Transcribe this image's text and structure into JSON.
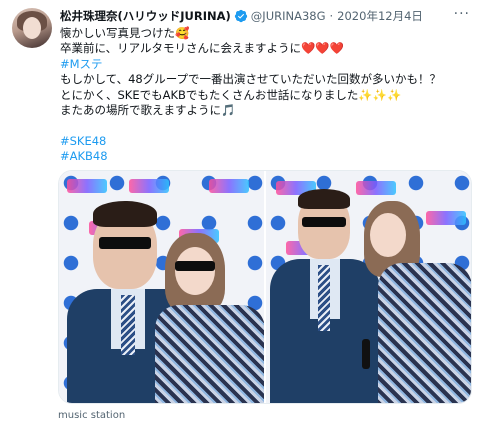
{
  "tweet": {
    "display_name": "松井珠理奈(ハリウッドJURINA)",
    "handle": "@JURINA38G",
    "separator": "·",
    "date": "2020年12月4日",
    "more_label": "···",
    "lines": [
      {
        "text": "懐かしい写真見つけた",
        "emoji": "🥰"
      },
      {
        "text": "卒業前に、リアルタモリさんに会えますように",
        "emoji": "❤️❤️❤️"
      },
      {
        "text": "#Mステ"
      },
      {
        "text": "もしかして、48グループで一番出演させていただいた回数が多いかも！？"
      },
      {
        "text": "とにかく、SKEでもAKBでもたくさんお世話になりました",
        "emoji": "✨✨✨"
      },
      {
        "text": "またあの場所で歌えますように",
        "emoji": "🎵"
      },
      {
        "text": ""
      },
      {
        "text": "#SKE48"
      },
      {
        "text": "#AKB48"
      }
    ],
    "media_caption": "music station"
  },
  "icons": {
    "verified": "verified-badge-icon",
    "more": "more-options-icon"
  },
  "colors": {
    "link": "#1d9bf0",
    "secondary_text": "#536471",
    "verified": "#1d9bf0"
  }
}
